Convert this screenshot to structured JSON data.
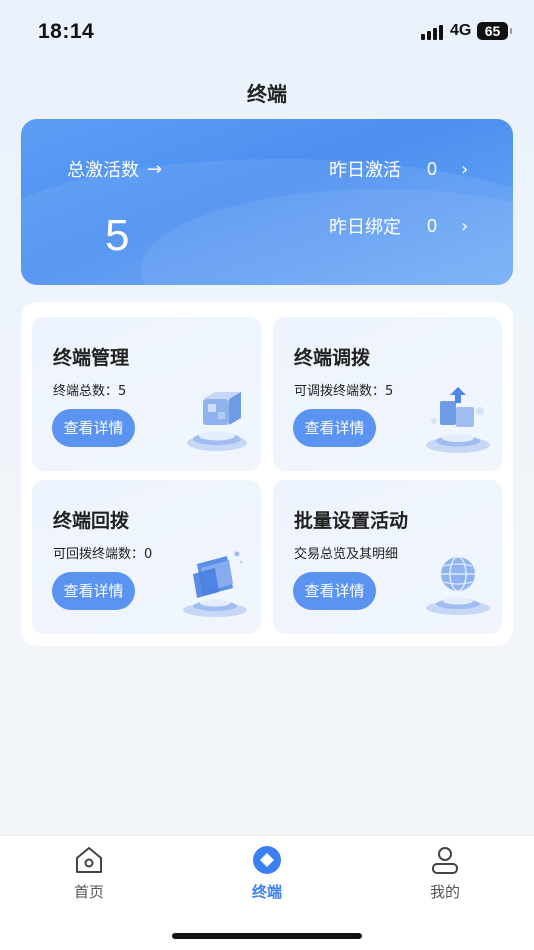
{
  "status_bar": {
    "time": "18:14",
    "network": "4G",
    "battery": "65"
  },
  "page_title": "终端",
  "summary": {
    "total_label": "总激活数",
    "total_arrow": "→",
    "total_value": "5",
    "yesterday_activated_label": "昨日激活",
    "yesterday_activated_value": "0",
    "yesterday_bound_label": "昨日绑定",
    "yesterday_bound_value": "0",
    "chevron": "›"
  },
  "cards": [
    {
      "title": "终端管理",
      "subtitle": "终端总数：5",
      "button": "查看详情",
      "icon": "cube-icon"
    },
    {
      "title": "终端调拨",
      "subtitle": "可调拨终端数：5",
      "button": "查看详情",
      "icon": "transfer-boxes-icon"
    },
    {
      "title": "终端回拨",
      "subtitle": "可回拨终端数：0",
      "button": "查看详情",
      "icon": "folder-return-icon"
    },
    {
      "title": "批量设置活动",
      "subtitle": "交易总览及其明细",
      "button": "查看详情",
      "icon": "globe-icon"
    }
  ],
  "tabbar": {
    "items": [
      {
        "label": "首页",
        "icon": "home-icon",
        "active": false
      },
      {
        "label": "终端",
        "icon": "terminal-diamond-icon",
        "active": true
      },
      {
        "label": "我的",
        "icon": "user-icon",
        "active": false
      }
    ]
  },
  "colors": {
    "accent": "#3b7ff0",
    "hero": "#5b9ef5",
    "button": "#5b93f1"
  }
}
